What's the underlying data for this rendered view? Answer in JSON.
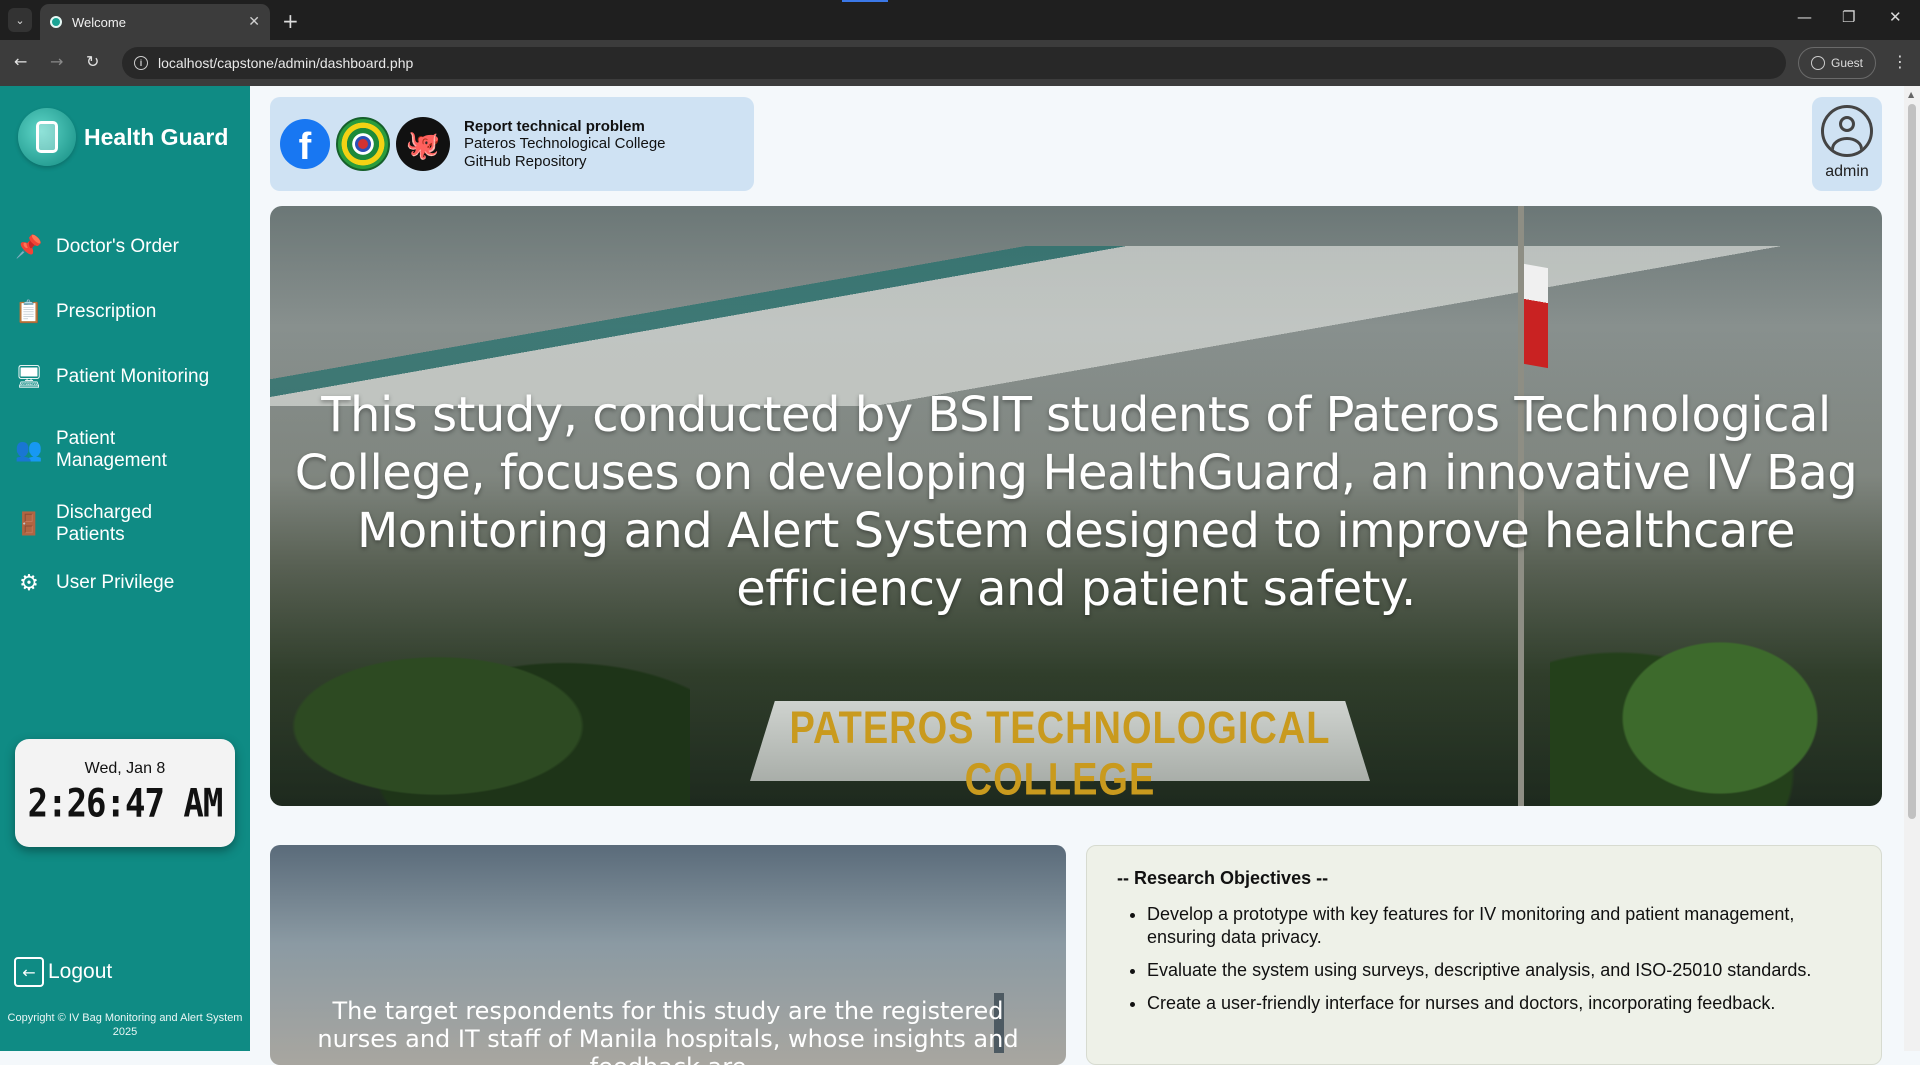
{
  "browser": {
    "tab_title": "Welcome",
    "url": "localhost/capstone/admin/dashboard.php",
    "profile_label": "Guest"
  },
  "sidebar": {
    "brand": "Health Guard",
    "items": [
      {
        "label": "Doctor's Order",
        "icon": "pin-icon"
      },
      {
        "label": "Prescription",
        "icon": "clipboard-icon"
      },
      {
        "label": "Patient Monitoring",
        "icon": "monitor-icon"
      },
      {
        "label": "Patient Management",
        "icon": "users-icon"
      },
      {
        "label": "Discharged Patients",
        "icon": "door-icon"
      },
      {
        "label": "User Privilege",
        "icon": "gear-icon"
      }
    ],
    "clock": {
      "date": "Wed, Jan 8",
      "time": "2:26:47 AM"
    },
    "logout": "Logout",
    "copyright": "Copyright © IV Bag Monitoring and Alert System 2025"
  },
  "links": {
    "report": "Report technical problem",
    "college": "Pateros Technological College",
    "github": "GitHub Repository"
  },
  "user": {
    "name": "admin"
  },
  "hero": {
    "headline": "This study, conducted by BSIT students of Pateros Technological College, focuses on developing HealthGuard, an innovative IV Bag Monitoring and Alert System designed to improve healthcare efficiency and patient safety.",
    "building_sign": "PATEROS TECHNOLOGICAL COLLEGE"
  },
  "respondents": {
    "text": "The target respondents for this study are the registered nurses and IT staff of Manila hospitals, whose insights and feedback are"
  },
  "objectives": {
    "heading": "-- Research Objectives --",
    "items": [
      "Develop a prototype with key features for IV monitoring and patient management, ensuring data privacy.",
      "Evaluate the system using surveys, descriptive analysis, and ISO-25010 standards.",
      "Create a user-friendly interface for nurses and doctors, incorporating feedback."
    ]
  },
  "colors": {
    "sidebar": "#0f8b84",
    "card": "#cfe2f3"
  }
}
